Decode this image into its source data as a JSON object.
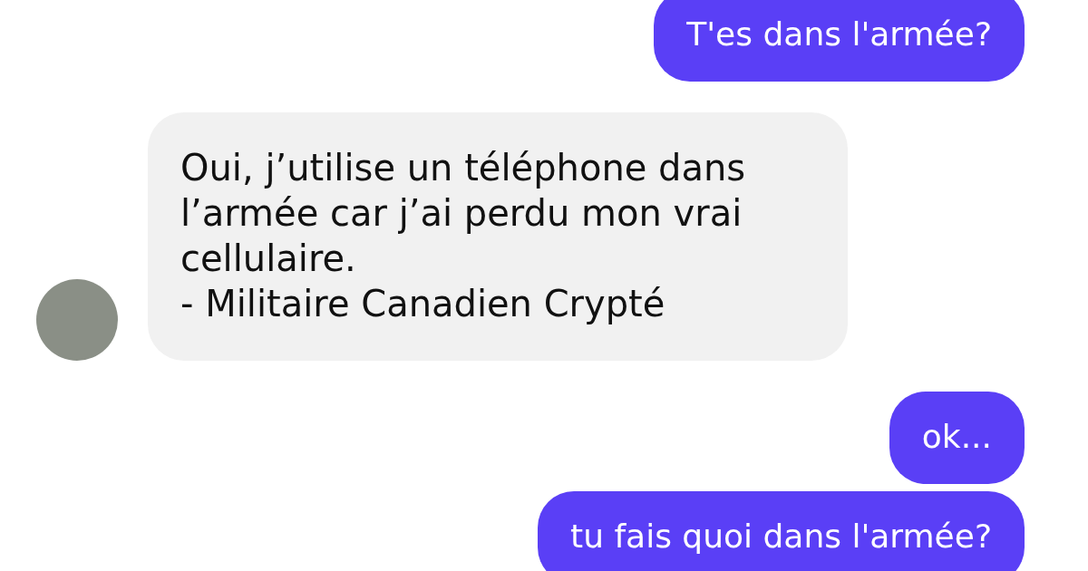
{
  "messages": [
    {
      "kind": "sent",
      "text": "T'es dans l'armée?"
    },
    {
      "kind": "received",
      "text": "Oui, j’utilise un téléphone dans l’armée car j’ai perdu mon vrai cellulaire.\n- Militaire Canadien Crypté",
      "avatar": true
    },
    {
      "kind": "sent",
      "text": "ok..."
    },
    {
      "kind": "sent",
      "text": "tu fais quoi dans l'armée?"
    }
  ]
}
